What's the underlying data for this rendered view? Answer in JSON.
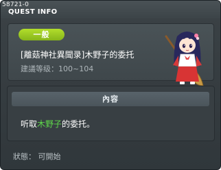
{
  "window": {
    "id_label": "58721-0",
    "title": "QUEST INFO"
  },
  "quest": {
    "category_badge": "一般",
    "name": "[離菇神社異聞录]木野子的委托",
    "level_range": "建議等级：100~104",
    "npc_icon": "shrine-maiden-npc-icon"
  },
  "content": {
    "header": "內容",
    "desc_prefix": "听取",
    "desc_highlight": "木野子",
    "desc_suffix": "的委托。"
  },
  "status": "狀態： 可開始",
  "colors": {
    "badge": "#9acb23",
    "highlight": "#5fd84a",
    "panel": "#3f474b"
  }
}
